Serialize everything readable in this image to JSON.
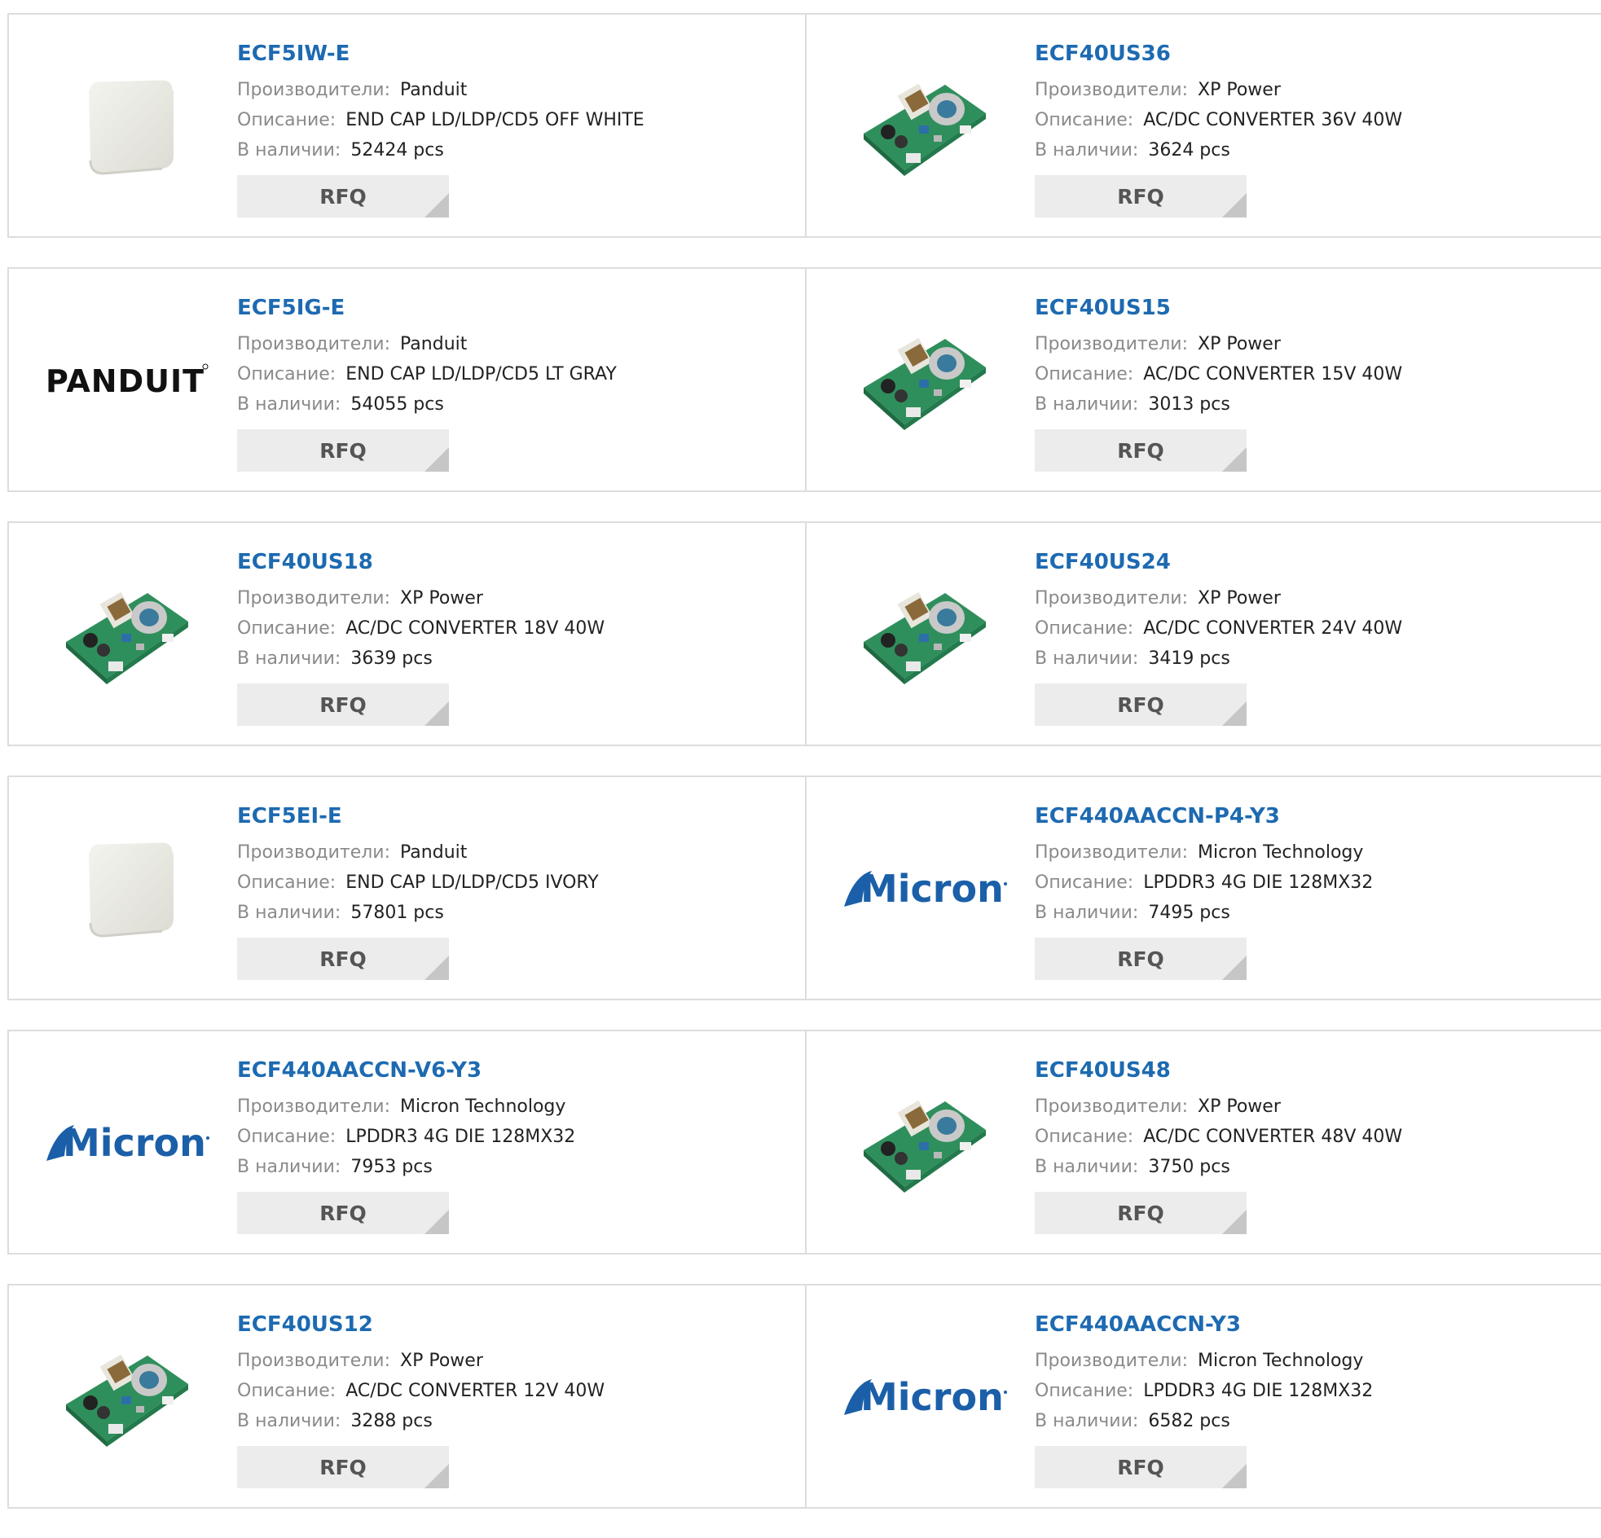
{
  "labels": {
    "manufacturer": "Производители:",
    "description": "Описание:",
    "stock": "В наличии:",
    "rfq": "RFQ"
  },
  "brand": {
    "panduit_logo_text": "PANDUIT",
    "micron_logo_text": "Micron",
    "link_color": "#1d6ab1"
  },
  "products": [
    {
      "pn": "ECF5IW-E",
      "manufacturer": "Panduit",
      "description": "END CAP LD/LDP/CD5 OFF WHITE",
      "stock": "52424 pcs",
      "image": "end-cap-white"
    },
    {
      "pn": "ECF40US36",
      "manufacturer": "XP Power",
      "description": "AC/DC CONVERTER 36V 40W",
      "stock": "3624 pcs",
      "image": "pcb-board"
    },
    {
      "pn": "ECF5IG-E",
      "manufacturer": "Panduit",
      "description": "END CAP LD/LDP/CD5 LT GRAY",
      "stock": "54055 pcs",
      "image": "panduit-logo"
    },
    {
      "pn": "ECF40US15",
      "manufacturer": "XP Power",
      "description": "AC/DC CONVERTER 15V 40W",
      "stock": "3013 pcs",
      "image": "pcb-board"
    },
    {
      "pn": "ECF40US18",
      "manufacturer": "XP Power",
      "description": "AC/DC CONVERTER 18V 40W",
      "stock": "3639 pcs",
      "image": "pcb-board"
    },
    {
      "pn": "ECF40US24",
      "manufacturer": "XP Power",
      "description": "AC/DC CONVERTER 24V 40W",
      "stock": "3419 pcs",
      "image": "pcb-board"
    },
    {
      "pn": "ECF5EI-E",
      "manufacturer": "Panduit",
      "description": "END CAP LD/LDP/CD5 IVORY",
      "stock": "57801 pcs",
      "image": "end-cap-white"
    },
    {
      "pn": "ECF440AACCN-P4-Y3",
      "manufacturer": "Micron Technology",
      "description": "LPDDR3 4G DIE 128MX32",
      "stock": "7495 pcs",
      "image": "micron-logo"
    },
    {
      "pn": "ECF440AACCN-V6-Y3",
      "manufacturer": "Micron Technology",
      "description": "LPDDR3 4G DIE 128MX32",
      "stock": "7953 pcs",
      "image": "micron-logo"
    },
    {
      "pn": "ECF40US48",
      "manufacturer": "XP Power",
      "description": "AC/DC CONVERTER 48V 40W",
      "stock": "3750 pcs",
      "image": "pcb-board"
    },
    {
      "pn": "ECF40US12",
      "manufacturer": "XP Power",
      "description": "AC/DC CONVERTER 12V 40W",
      "stock": "3288 pcs",
      "image": "pcb-board"
    },
    {
      "pn": "ECF440AACCN-Y3",
      "manufacturer": "Micron Technology",
      "description": "LPDDR3 4G DIE 128MX32",
      "stock": "6582 pcs",
      "image": "micron-logo"
    }
  ]
}
